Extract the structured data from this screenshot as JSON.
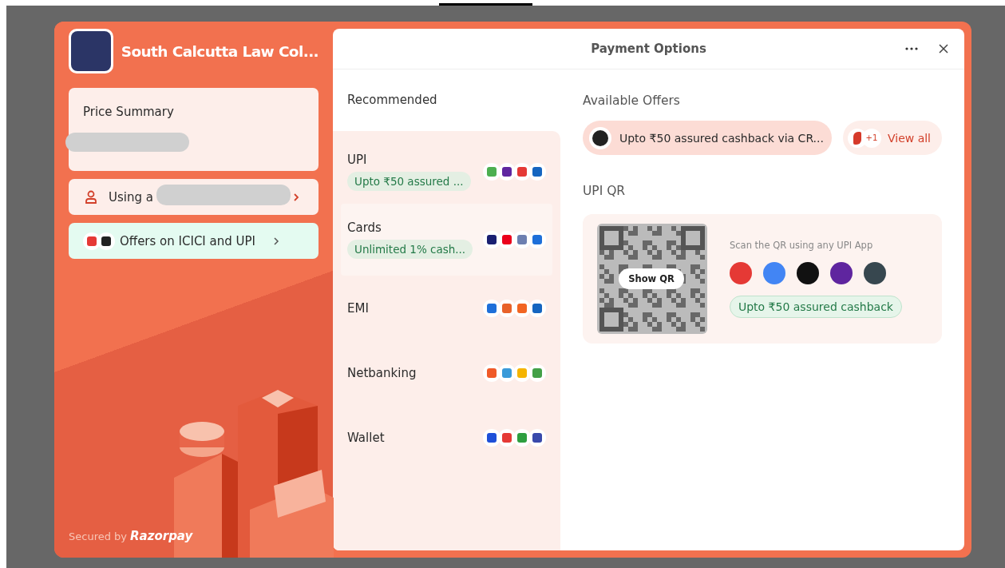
{
  "merchant": {
    "name": "South Calcutta Law Col..."
  },
  "price_summary": {
    "title": "Price Summary"
  },
  "user_row": {
    "text": "Using a"
  },
  "offers_row": {
    "text": "Offers on ICICI and UPI"
  },
  "footer": {
    "secured_by": "Secured by",
    "brand": "Razorpay"
  },
  "panel": {
    "title": "Payment Options"
  },
  "methods_heading": "Recommended",
  "methods": [
    {
      "name": "UPI",
      "offer": "Upto ₹50 assured ...",
      "selected": false,
      "logos": [
        {
          "color": "#4caf50"
        },
        {
          "color": "#5f259f"
        },
        {
          "color": "#e53935"
        },
        {
          "color": "#1565c0"
        }
      ]
    },
    {
      "name": "Cards",
      "offer": "Unlimited 1% cash...",
      "selected": true,
      "logos": [
        {
          "color": "#1a1f71"
        },
        {
          "color": "#eb001b"
        },
        {
          "color": "#6d7fb0"
        },
        {
          "color": "#1e6fd9"
        }
      ]
    },
    {
      "name": "EMI",
      "selected": false,
      "logos": [
        {
          "color": "#1e6fd9"
        },
        {
          "color": "#e8622a"
        },
        {
          "color": "#f26522"
        },
        {
          "color": "#1565c0"
        }
      ]
    },
    {
      "name": "Netbanking",
      "selected": false,
      "logos": [
        {
          "color": "#f05a28"
        },
        {
          "color": "#3a9ad9"
        },
        {
          "color": "#f5b400"
        },
        {
          "color": "#43a047"
        }
      ]
    },
    {
      "name": "Wallet",
      "selected": false,
      "logos": [
        {
          "color": "#1e4fd8"
        },
        {
          "color": "#e53935"
        },
        {
          "color": "#2e9e3f"
        },
        {
          "color": "#3949ab"
        }
      ]
    }
  ],
  "offers": {
    "heading": "Available Offers",
    "offer": "Upto ₹50 assured cashback via CR...",
    "more_count": "+1",
    "view_all": "View all"
  },
  "upi_qr": {
    "heading": "UPI QR",
    "button": "Show QR",
    "hint": "Scan the QR using any UPI App",
    "apps": [
      {
        "color": "#e53935"
      },
      {
        "color": "#4285f4"
      },
      {
        "color": "#111111"
      },
      {
        "color": "#5f259f"
      },
      {
        "color": "#37474f"
      }
    ],
    "cashback": "Upto ₹50 assured cashback"
  }
}
